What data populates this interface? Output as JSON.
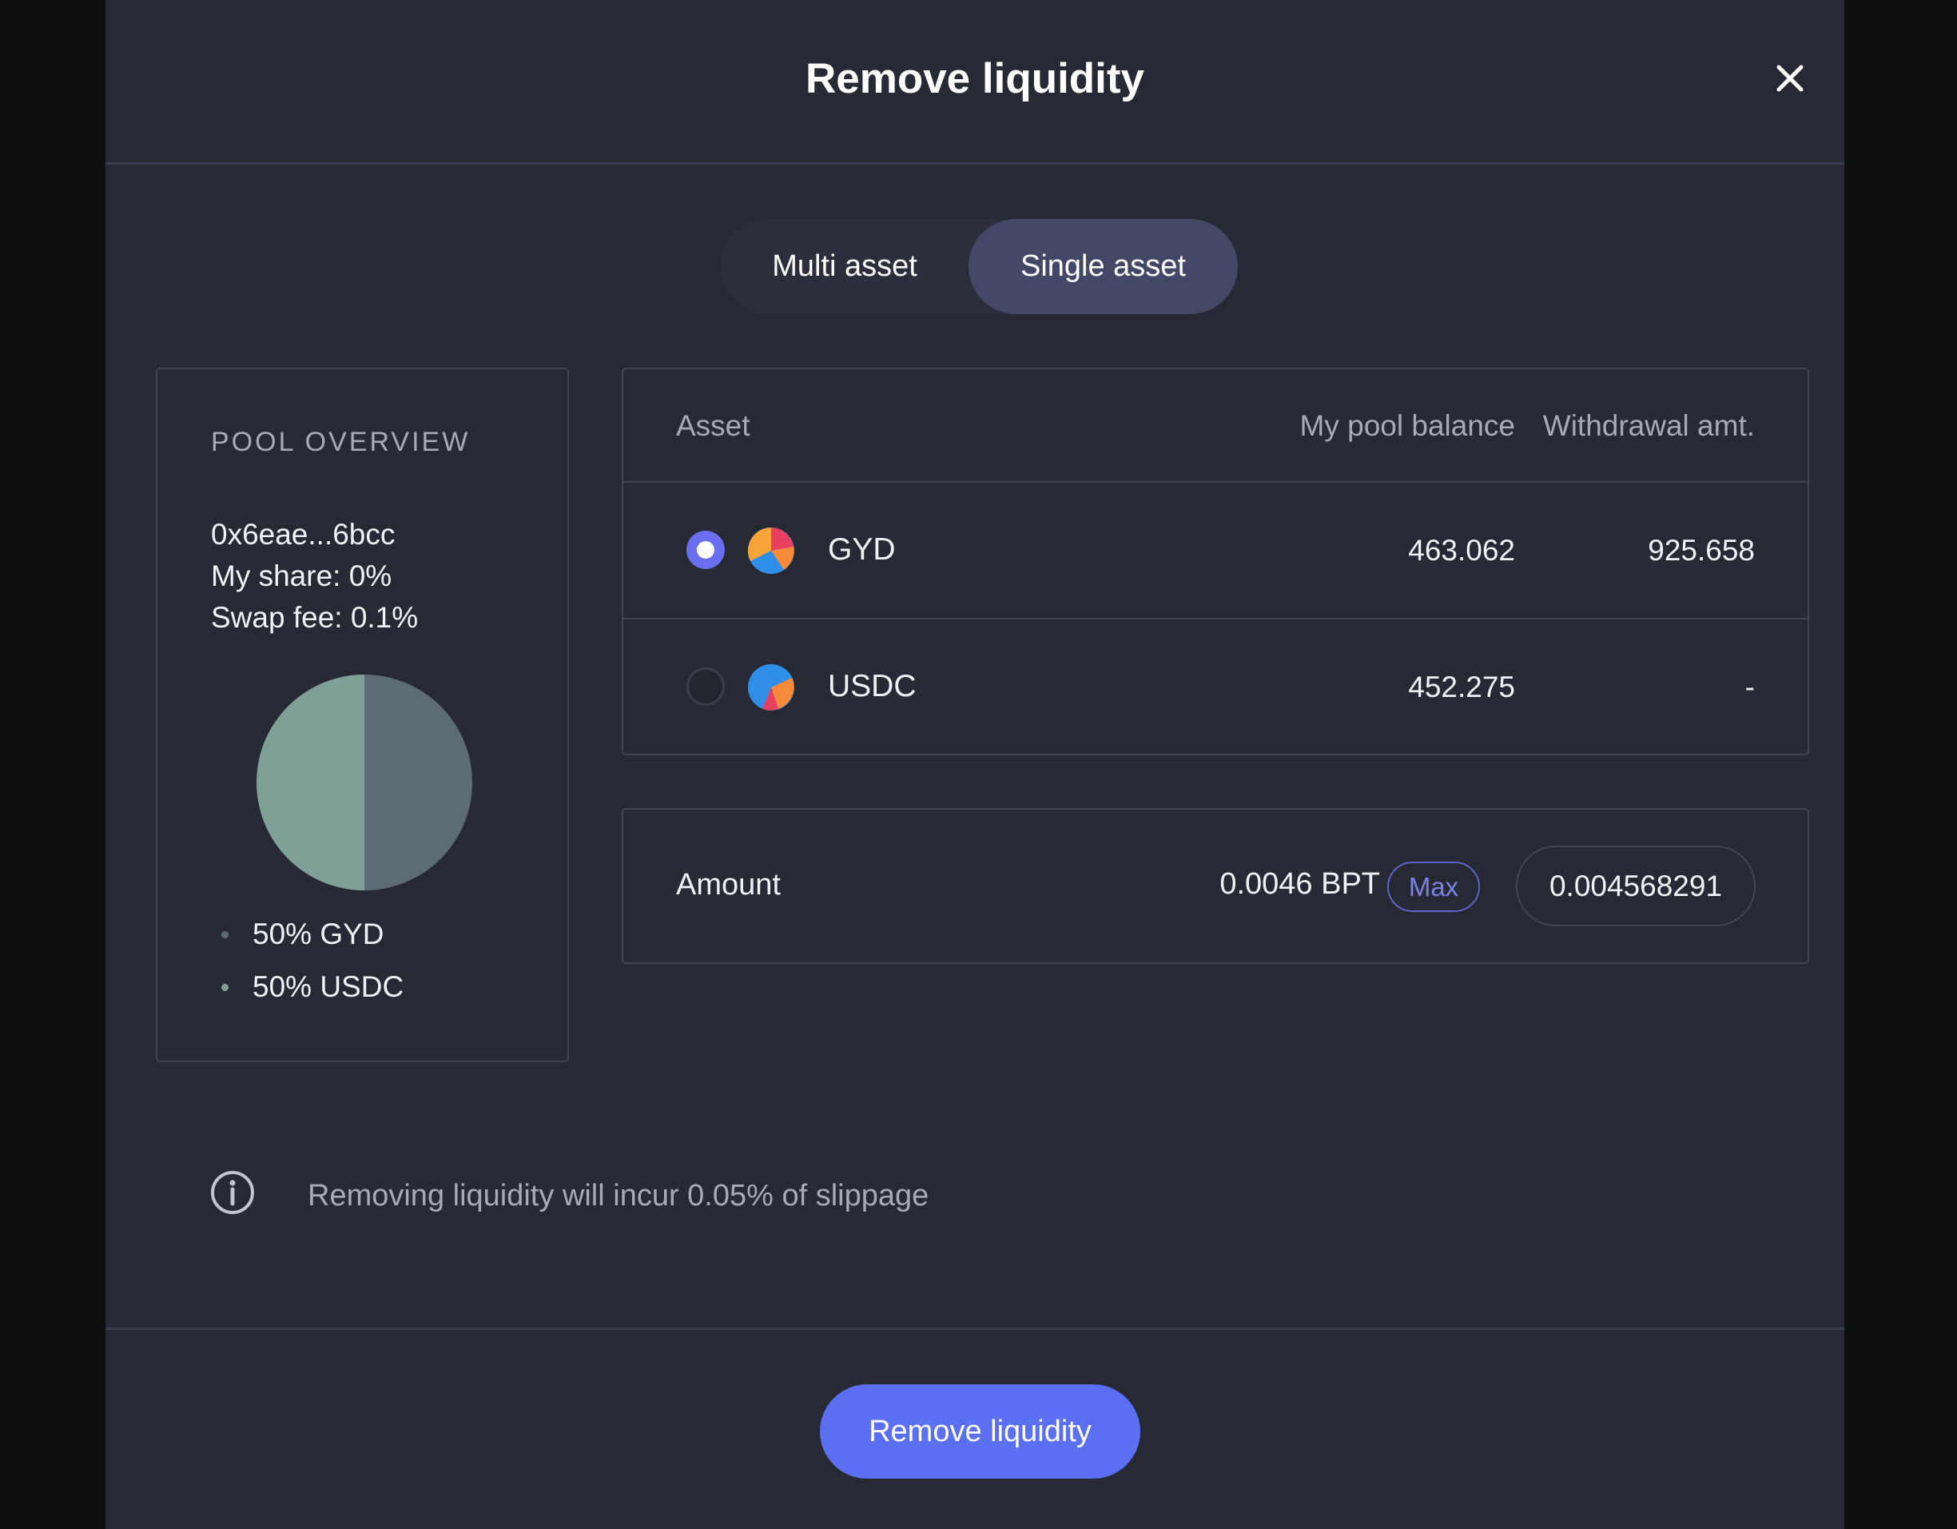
{
  "modal": {
    "title": "Remove liquidity",
    "close_icon": "close-icon"
  },
  "toggle": {
    "options": [
      "Multi asset",
      "Single asset"
    ],
    "selected": "Single asset"
  },
  "overview": {
    "heading": "POOL OVERVIEW",
    "address": "0x6eae...6bcc",
    "my_share": "My share: 0%",
    "swap_fee": "Swap fee: 0.1%",
    "pie": {
      "slices": [
        {
          "label": "50% GYD",
          "value": 50,
          "color": "#7fa097"
        },
        {
          "label": "50% USDC",
          "value": 50,
          "color": "#5d6b74"
        }
      ]
    }
  },
  "table": {
    "headers": {
      "asset": "Asset",
      "balance": "My pool balance",
      "withdrawal": "Withdrawal amt."
    },
    "rows": [
      {
        "token": "GYD",
        "balance": "463.062",
        "withdrawal": "925.658",
        "selected": true,
        "icon": "gyd-token-icon"
      },
      {
        "token": "USDC",
        "balance": "452.275",
        "withdrawal": "-",
        "selected": false,
        "icon": "usdc-token-icon"
      }
    ]
  },
  "amount": {
    "label": "Amount",
    "bpt": "0.0046 BPT",
    "max_label": "Max",
    "value": "0.004568291"
  },
  "info": {
    "icon": "info-icon",
    "text": "Removing liquidity will incur 0.05% of slippage"
  },
  "footer": {
    "button_label": "Remove liquidity"
  },
  "colors": {
    "accent": "#5b6ff2",
    "radio_selected": "#6a6ff0",
    "toggle_selected": "#434866",
    "background": "#272935"
  }
}
